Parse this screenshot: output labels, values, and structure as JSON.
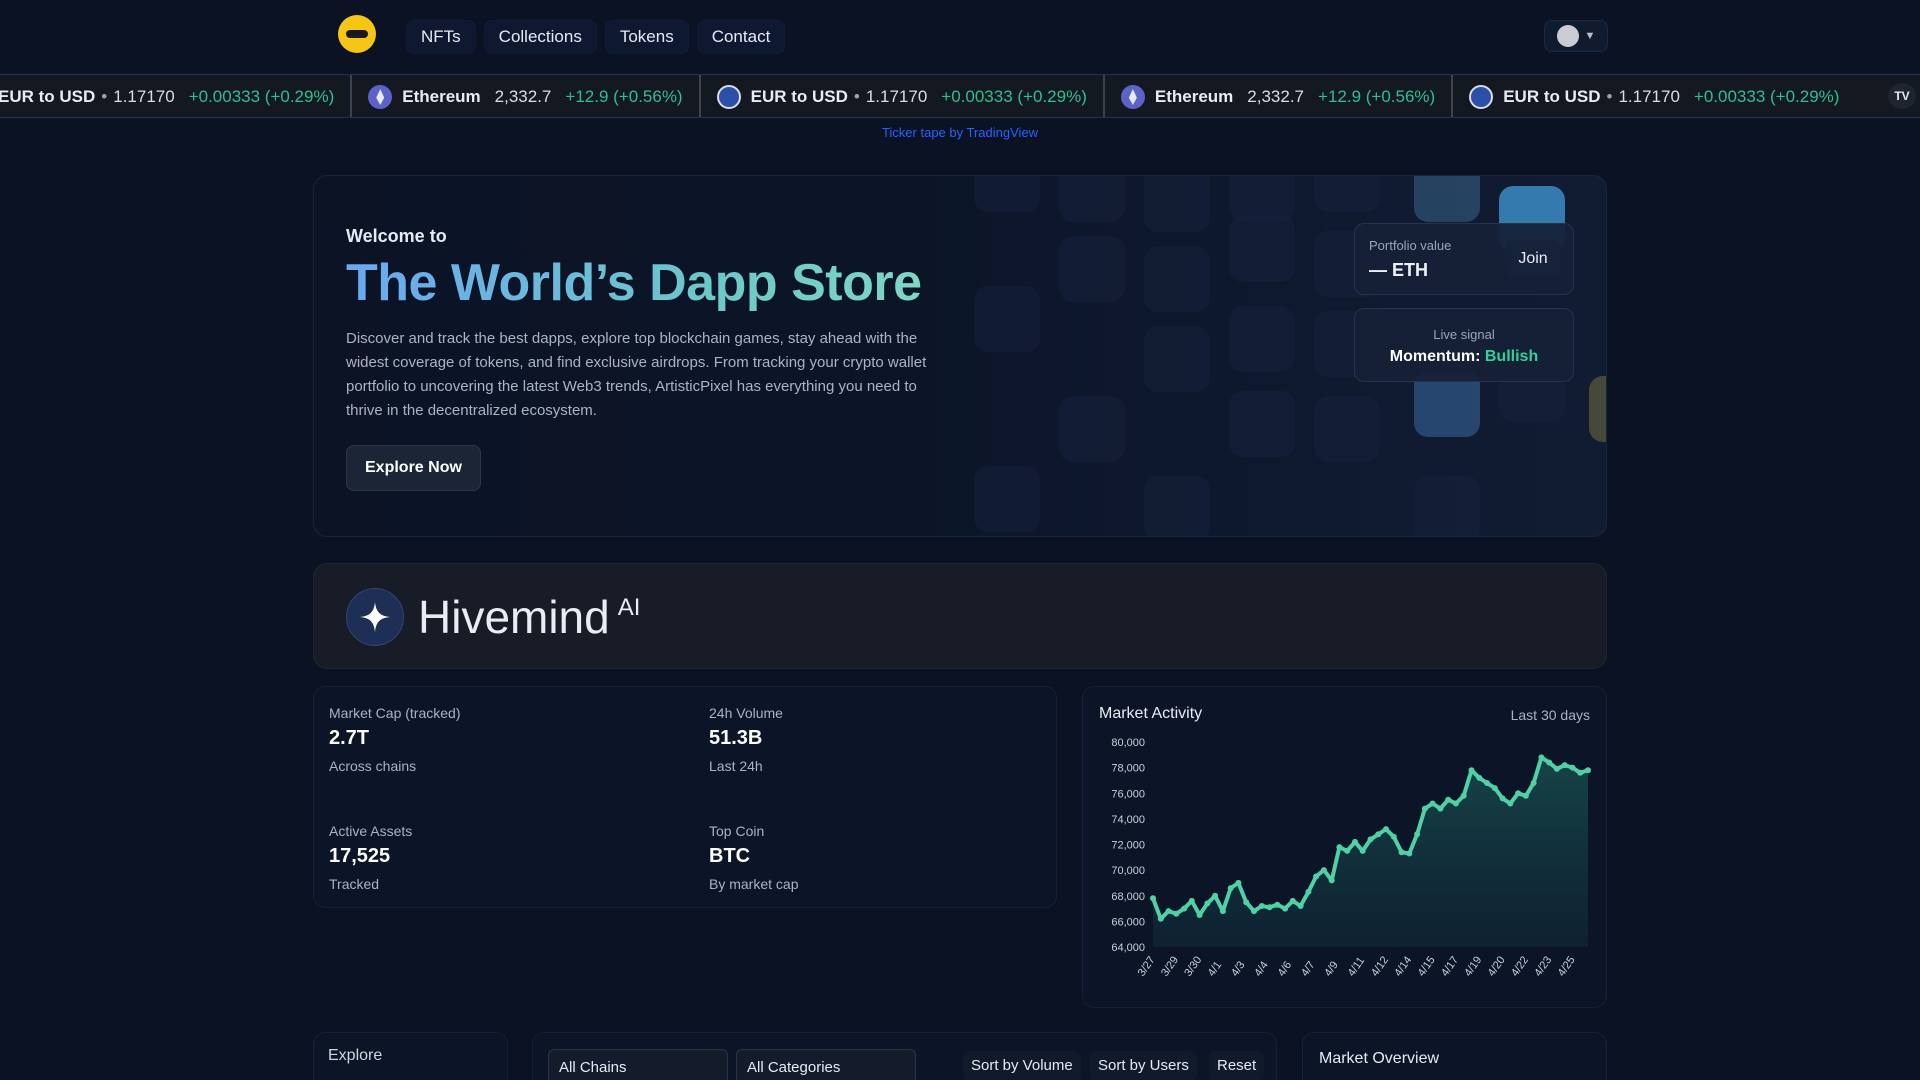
{
  "nav": {
    "items": [
      {
        "label": "NFTs"
      },
      {
        "label": "Collections"
      },
      {
        "label": "Tokens"
      },
      {
        "label": "Contact"
      }
    ]
  },
  "ticker": {
    "items": [
      {
        "symbol": "EUR to USD",
        "price": "1.17170",
        "change": "+0.00333 (+0.29%)",
        "icon": "eur-usd-flag-icon"
      },
      {
        "symbol": "Ethereum",
        "price": "2,332.7",
        "change": "+12.9 (+0.56%)",
        "icon": "ethereum-icon"
      },
      {
        "symbol": "EUR to USD",
        "price": "1.17170",
        "change": "+0.00333 (+0.29%)",
        "icon": "eur-usd-flag-icon"
      },
      {
        "symbol": "Ethereum",
        "price": "2,332.7",
        "change": "+12.9 (+0.56%)",
        "icon": "ethereum-icon"
      },
      {
        "symbol": "EUR to USD",
        "price": "1.17170",
        "change": "+0.00333 (+0.29%)",
        "icon": "eur-usd-flag-icon"
      }
    ],
    "dot": "•",
    "caption": "Ticker tape by TradingView",
    "badge": "TV"
  },
  "hero": {
    "welcome": "Welcome to",
    "title": "The World’s Dapp Store",
    "description": "Discover and track the best dapps, explore top blockchain games, stay ahead with the widest coverage of tokens, and find exclusive airdrops. From tracking your crypto wallet portfolio to uncovering the latest Web3 trends, ArtisticPixel has everything you need to thrive in the decentralized ecosystem.",
    "cta": "Explore Now",
    "portfolio": {
      "label": "Portfolio value",
      "value": "— ETH",
      "join": "Join"
    },
    "signal": {
      "label": "Live signal",
      "momentum_label": "Momentum:",
      "momentum_value": "Bullish"
    }
  },
  "hivemind": {
    "title": "Hivemind",
    "suffix": "AI"
  },
  "stats": [
    {
      "label": "Market Cap (tracked)",
      "value": "2.7T",
      "sub": "Across chains"
    },
    {
      "label": "24h Volume",
      "value": "51.3B",
      "sub": "Last 24h"
    },
    {
      "label": "Active Assets",
      "value": "17,525",
      "sub": "Tracked"
    },
    {
      "label": "Top Coin",
      "value": "BTC",
      "sub": "By market cap"
    }
  ],
  "chart_data": {
    "type": "area",
    "title": "Market Activity",
    "range_label": "Last 30 days",
    "ylim": [
      64000,
      80000
    ],
    "y_ticks": [
      "64,000",
      "66,000",
      "68,000",
      "70,000",
      "72,000",
      "74,000",
      "76,000",
      "78,000",
      "80,000"
    ],
    "x_ticks": [
      "3/27",
      "3/29",
      "3/30",
      "4/1",
      "4/3",
      "4/4",
      "4/6",
      "4/7",
      "4/9",
      "4/11",
      "4/12",
      "4/14",
      "4/15",
      "4/17",
      "4/19",
      "4/20",
      "4/22",
      "4/23",
      "4/25"
    ],
    "values": [
      67800,
      66200,
      66800,
      66600,
      67000,
      67600,
      66500,
      67400,
      68000,
      66800,
      68600,
      69000,
      67500,
      66800,
      67200,
      67100,
      67300,
      67000,
      67600,
      67200,
      68300,
      69500,
      70000,
      69200,
      71800,
      71500,
      72200,
      71500,
      72400,
      72800,
      73200,
      72600,
      71400,
      71300,
      72800,
      74800,
      75200,
      74800,
      75500,
      75200,
      75800,
      77800,
      77200,
      76800,
      76400,
      75600,
      75200,
      76000,
      75800,
      76800,
      78800,
      78400,
      77900,
      78200,
      78000,
      77600,
      77800
    ],
    "color": "#4fd1a5"
  },
  "bottom": {
    "explore": "Explore",
    "chains": "All Chains",
    "categories": "All Categories",
    "sort_volume": "Sort by Volume",
    "sort_users": "Sort by Users",
    "reset": "Reset",
    "market_overview": "Market Overview"
  }
}
